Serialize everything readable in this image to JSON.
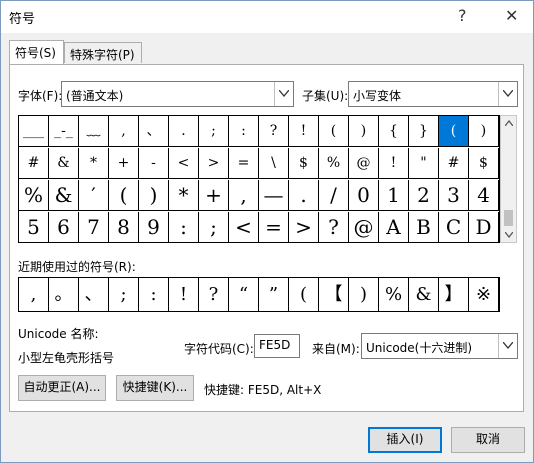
{
  "window": {
    "title": "符号",
    "help": "?",
    "close": "✕"
  },
  "tabs": [
    {
      "label": "符号(S)"
    },
    {
      "label": "特殊字符(P)"
    }
  ],
  "font": {
    "label": "字体(F):",
    "value": "(普通文本)"
  },
  "subset": {
    "label": "子集(U):",
    "value": "小写变体"
  },
  "symbol_rows": [
    [
      "___",
      "_-_",
      "﹏",
      ",",
      "、",
      ".",
      ";",
      ":",
      "?",
      "!",
      "(",
      ")",
      "{",
      "}",
      "(",
      ")"
    ],
    [
      "#",
      "&",
      "*",
      "+",
      "-",
      "<",
      ">",
      "=",
      "\\",
      "$",
      "%",
      "@",
      "!",
      "\"",
      "#",
      "$"
    ],
    [
      "%",
      "&",
      "′",
      "(",
      ")",
      "*",
      "+",
      ",",
      "—",
      ".",
      "/",
      "0",
      "1",
      "2",
      "3",
      "4"
    ],
    [
      "5",
      "6",
      "7",
      "8",
      "9",
      ":",
      ";",
      "<",
      "=",
      ">",
      "?",
      "@",
      "A",
      "B",
      "C",
      "D"
    ]
  ],
  "selected_symbol": {
    "row": 0,
    "col": 14
  },
  "recent": {
    "label": "近期使用过的符号(R):",
    "symbols": [
      ",",
      "。",
      "、",
      ";",
      ":",
      "!",
      "?",
      "“",
      "”",
      "(",
      "【",
      ")",
      "%",
      "&",
      "】",
      "※"
    ]
  },
  "unicode_name": {
    "label": "Unicode 名称:",
    "value": "小型左龟壳形括号"
  },
  "char_code": {
    "label": "字符代码(C):",
    "value": "FE5D"
  },
  "from": {
    "label": "来自(M):",
    "value": "Unicode(十六进制)"
  },
  "buttons": {
    "autocorrect": "自动更正(A)...",
    "shortcut": "快捷键(K)...",
    "shortcut_info": "快捷键: FE5D, Alt+X",
    "insert": "插入(I)",
    "cancel": "取消"
  }
}
